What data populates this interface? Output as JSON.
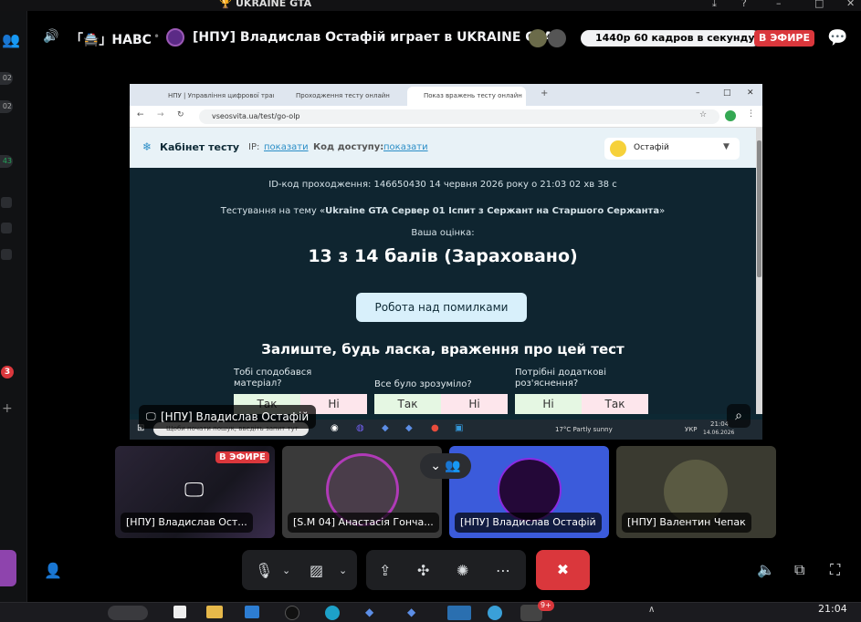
{
  "window": {
    "title": "UKRAINE GTA",
    "controls": [
      "–",
      "□",
      "✕"
    ]
  },
  "left_strip": {
    "badges": [
      "02",
      "02",
      "43"
    ],
    "notification_count": "3",
    "add": "+"
  },
  "header": {
    "channel_prefix": "「🚔」НАВС",
    "stream_title": "[НПУ] Владислав Остафій играет в UKRAINE GTA",
    "quality": "1440р 60 кадров в секунду",
    "live_badge": "В ЭФИРЕ"
  },
  "browser": {
    "tabs": [
      {
        "label": "НПУ | Управління цифрової трансформації"
      },
      {
        "label": "Проходження тесту онлайн"
      },
      {
        "label": "Показ вражень тесту онлайн"
      }
    ],
    "url": "vseosvita.ua/test/go-olp",
    "site": {
      "brand": "Кабінет тесту",
      "ip_label": "IP:",
      "ip_link": "показати",
      "code_label": "Код доступу:",
      "code_link": "показати",
      "user": "Остафій"
    },
    "result": {
      "id_line": "ID-код проходження: 146650430     14 червня 2026 року о 21:03 02 хв 38 с",
      "test_prefix": "Тестування на тему «",
      "test_name": "Ukraine GTA Сервер 01 Іспит з Сержант на Старшого Сержанта",
      "test_suffix": "»",
      "grade_label": "Ваша оцінка:",
      "score": "13 з 14 балів (Зараховано)",
      "mistakes_button": "Робота над помилками",
      "feedback_title": "Залиште, будь ласка, враження про цей тест",
      "questions": [
        {
          "q": "Тобі сподобався матеріал?",
          "opt1": "Так",
          "opt2": "Ні"
        },
        {
          "q": "Все було зрозуміло?",
          "opt1": "Так",
          "opt2": "Ні"
        },
        {
          "q": "Потрібні додаткові роз'яснення?",
          "opt1": "Ні",
          "opt2": "Так"
        }
      ]
    },
    "win_taskbar": {
      "search": "Щоби почати пошук, введіть запит тут",
      "weather": "17°C  Partly sunny",
      "lang": "УКР",
      "time": "21:04",
      "date": "14.06.2026"
    }
  },
  "stream_overlay": {
    "name": "[НПУ] Владислав Остафій"
  },
  "tiles": [
    {
      "label": "[НПУ] Владислав Ост...",
      "live": "В ЭФИРЕ"
    },
    {
      "label": "[S.M 04] Анастасія Гонча..."
    },
    {
      "label": "[НПУ] Владислав Остафій"
    },
    {
      "label": "[НПУ] Валентин Чепак"
    }
  ],
  "os_taskbar": {
    "time": "21:04",
    "badge": "9+"
  },
  "colors": {
    "accent_red": "#da373c",
    "site_dark": "#0f2530",
    "stage_blue": "#3b5bdb"
  }
}
